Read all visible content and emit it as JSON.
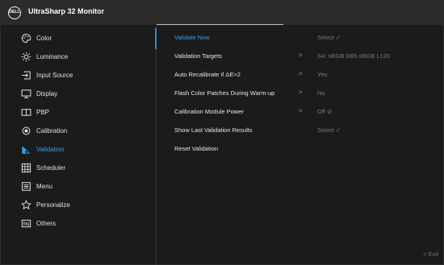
{
  "header": {
    "logo_text": "DELL",
    "title": "UltraSharp 32 Monitor"
  },
  "nav": [
    {
      "label": "Color",
      "icon": "color-palette-icon"
    },
    {
      "label": "Luminance",
      "icon": "sun-icon"
    },
    {
      "label": "Input Source",
      "icon": "input-source-icon"
    },
    {
      "label": "Display",
      "icon": "display-icon"
    },
    {
      "label": "PBP",
      "icon": "pbp-icon"
    },
    {
      "label": "Calibration",
      "icon": "calibration-icon"
    },
    {
      "label": "Validation",
      "icon": "validation-icon",
      "active": true
    },
    {
      "label": "Scheduler",
      "icon": "scheduler-icon"
    },
    {
      "label": "Menu",
      "icon": "menu-icon"
    },
    {
      "label": "Personalize",
      "icon": "star-icon"
    },
    {
      "label": "Others",
      "icon": "others-icon"
    }
  ],
  "rows": [
    {
      "label": "Validate Now",
      "value": "Select ✓",
      "chevron": false,
      "active": true
    },
    {
      "label": "Validation Targets",
      "value": "S4: sRGB D65 sRGB L120",
      "chevron": true
    },
    {
      "label": "Auto Recalibrate if ΔE>2",
      "value": "Yes",
      "chevron": true
    },
    {
      "label": "Flash Color Patches During Warm-up",
      "value": "No",
      "chevron": true
    },
    {
      "label": "Calibration Module Power",
      "value": "Off ⊘",
      "chevron": true
    },
    {
      "label": "Show Last Validation Results",
      "value": "Select ✓",
      "chevron": false
    },
    {
      "label": "Reset Validation",
      "value": "",
      "chevron": false
    }
  ],
  "chevron_glyph": ">",
  "exit_label": "< Exit",
  "colors": {
    "accent": "#3b9de6",
    "background": "#1b1b1b",
    "header": "#2b2b2b"
  }
}
